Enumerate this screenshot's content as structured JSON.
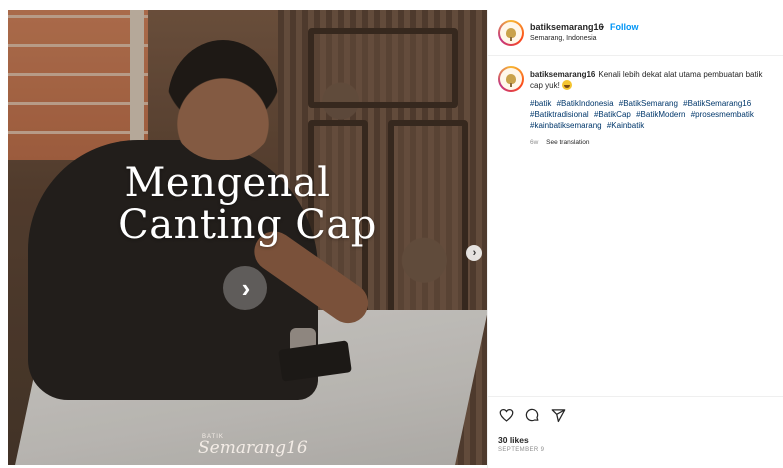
{
  "media": {
    "headline_line1": "Mengenal",
    "headline_line2": "Canting Cap",
    "watermark_small": "BATIK",
    "watermark_big": "Semarang16",
    "next_icon": "chevron-right-icon",
    "carousel_next_icon": "chevron-right-icon"
  },
  "header": {
    "username": "batiksemarang16",
    "separator": "•",
    "follow_label": "Follow",
    "location": "Semarang, Indonesia"
  },
  "caption": {
    "username": "batiksemarang16",
    "text": "Kenali lebih dekat alat utama pembuatan batik",
    "text_cont": "cap yuk!",
    "hashtags": [
      "#batik",
      "#BatikIndonesia",
      "#BatikSemarang",
      "#BatikSemarang16",
      "#Batiktradisional",
      "#BatikCap",
      "#BatikModern",
      "#prosesmembatik",
      "#kainbatiksemarang",
      "#Kainbatik"
    ],
    "age": "6w",
    "see_translation": "See translation"
  },
  "actions": {
    "like_icon": "heart-icon",
    "comment_icon": "comment-icon",
    "share_icon": "send-icon",
    "likes": "30 likes",
    "date": "SEPTEMBER 9"
  },
  "colors": {
    "link_blue": "#0095f6",
    "hashtag": "#00376b",
    "muted": "#8e8e8e",
    "text": "#262626"
  }
}
